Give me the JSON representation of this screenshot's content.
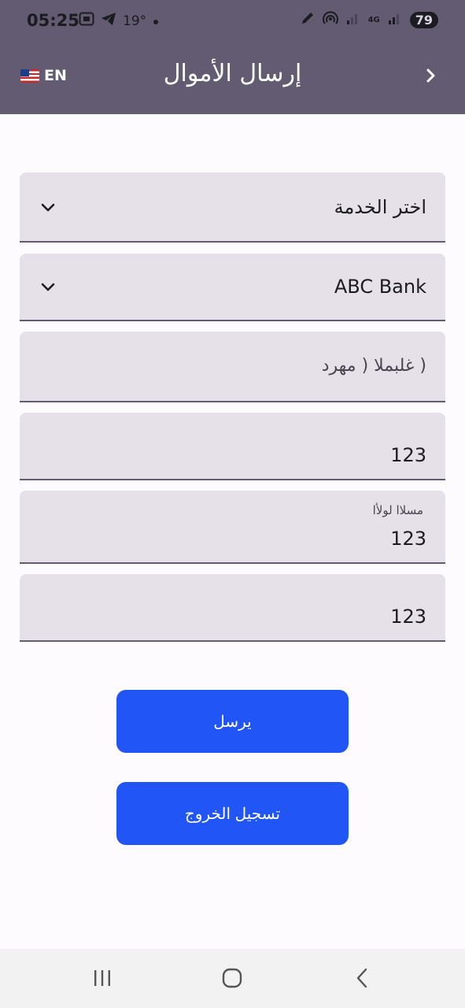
{
  "status_bar": {
    "time": "05:25",
    "temperature": "19°",
    "network_label": "4G",
    "battery": "79",
    "icons": [
      "screenshot-icon",
      "telegram-icon",
      "dot-icon",
      "pen-icon",
      "hotspot-icon",
      "signal-icon",
      "signal-icon",
      "battery-icon"
    ]
  },
  "app_bar": {
    "title": "إرسال الأموال",
    "language": "EN",
    "language_flag": "us-flag-icon",
    "back_icon": "chevron-right-icon",
    "background": "#625b71"
  },
  "form": {
    "service": {
      "value": "اختر الخدمة"
    },
    "bank": {
      "value": "ABC Bank"
    },
    "amount_currency": {
      "placeholder": "( غلبملا ( مهرد"
    },
    "field_4": {
      "value": "123"
    },
    "field_5": {
      "label": "مسلاا لولأا",
      "value": "123"
    },
    "field_6": {
      "value": "123"
    }
  },
  "buttons": {
    "send": "يرسل",
    "logout": "تسجيل الخروج",
    "color": "#2255f5"
  },
  "nav_bar": {
    "icons": [
      "recent-apps-icon",
      "home-icon",
      "back-icon"
    ]
  }
}
